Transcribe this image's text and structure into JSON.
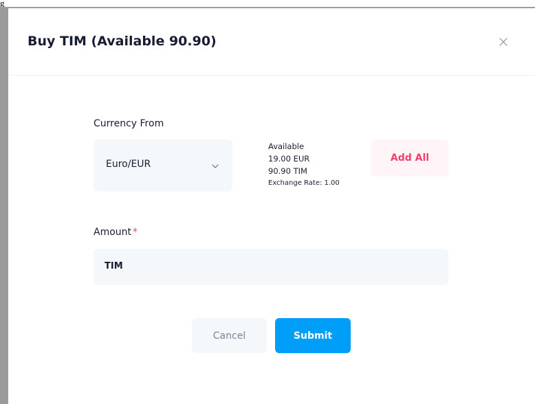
{
  "page": {
    "top_label": "g"
  },
  "modal": {
    "title": "Buy TIM (Available 90.90)",
    "close_icon": "close-icon"
  },
  "currency_from": {
    "label": "Currency From",
    "selected": "Euro/EUR",
    "chevron_icon": "chevron-down-icon"
  },
  "available": {
    "heading": "Available",
    "eur": "19.00 EUR",
    "tim": "90.90 TIM",
    "exchange_rate": "Exchange Rate: 1.00"
  },
  "add_all": {
    "label": "Add All"
  },
  "amount": {
    "label": "Amount",
    "required_mark": "*",
    "prefix": "TIM",
    "value": ""
  },
  "actions": {
    "cancel_label": "Cancel",
    "submit_label": "Submit"
  },
  "colors": {
    "primary": "#009ef7",
    "danger": "#f1416c",
    "danger_light": "#fff5f8",
    "input_bg": "#f5f8fa",
    "backdrop": "#9b9b9b"
  }
}
